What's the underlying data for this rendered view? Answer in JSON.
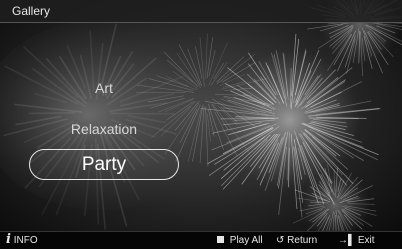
{
  "header": {
    "title": "Gallery"
  },
  "menu": {
    "items": [
      "Art",
      "Relaxation",
      "Party"
    ],
    "selected": "Party"
  },
  "footer": {
    "info": {
      "icon": "info-icon",
      "label": "INFO"
    },
    "play_all": {
      "icon": "stop-square-icon",
      "label": "Play All"
    },
    "return": {
      "icon": "return-arrow-icon",
      "label": "Return"
    },
    "exit": {
      "icon": "exit-door-icon",
      "label": "Exit"
    }
  }
}
